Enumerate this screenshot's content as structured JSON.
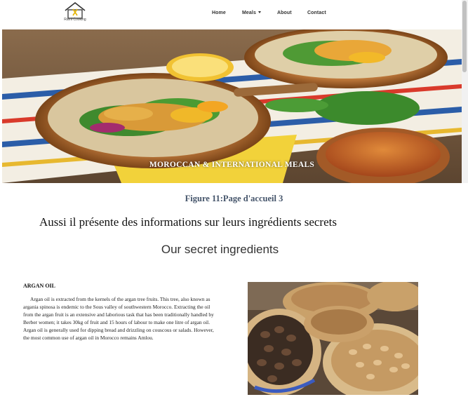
{
  "site": {
    "logo_text": "Rami Cooking"
  },
  "nav": {
    "home": "Home",
    "meals": "Meals",
    "about": "About",
    "contact": "Contact"
  },
  "hero": {
    "title": "MOROCCAN & INTERNATIONAL MEALS",
    "prev_glyph": "‹"
  },
  "document": {
    "caption": "Figure 11:Page d'accueil 3",
    "intro": "Aussi il présente des informations sur leurs ingrédients secrets"
  },
  "secret": {
    "title": "Our secret ingredients",
    "ingredient_name": "ARGAN OIL",
    "ingredient_desc": "Argan oil is extracted from the kernels of the argan tree fruits. This tree, also known as argania spinosa is endemic to the Sous valley of southwestern Morocco. Extracting the oil from the argan fruit is an extensive and laborious task that has been traditionally handled by Berber women; it takes 30kg of fruit and 15 hours of labour to make one litre of argan oil. Argan oil is generally used for dipping bread and drizzling on couscous or salads. However, the most common use of argan oil in Morocco remains Amlou."
  }
}
